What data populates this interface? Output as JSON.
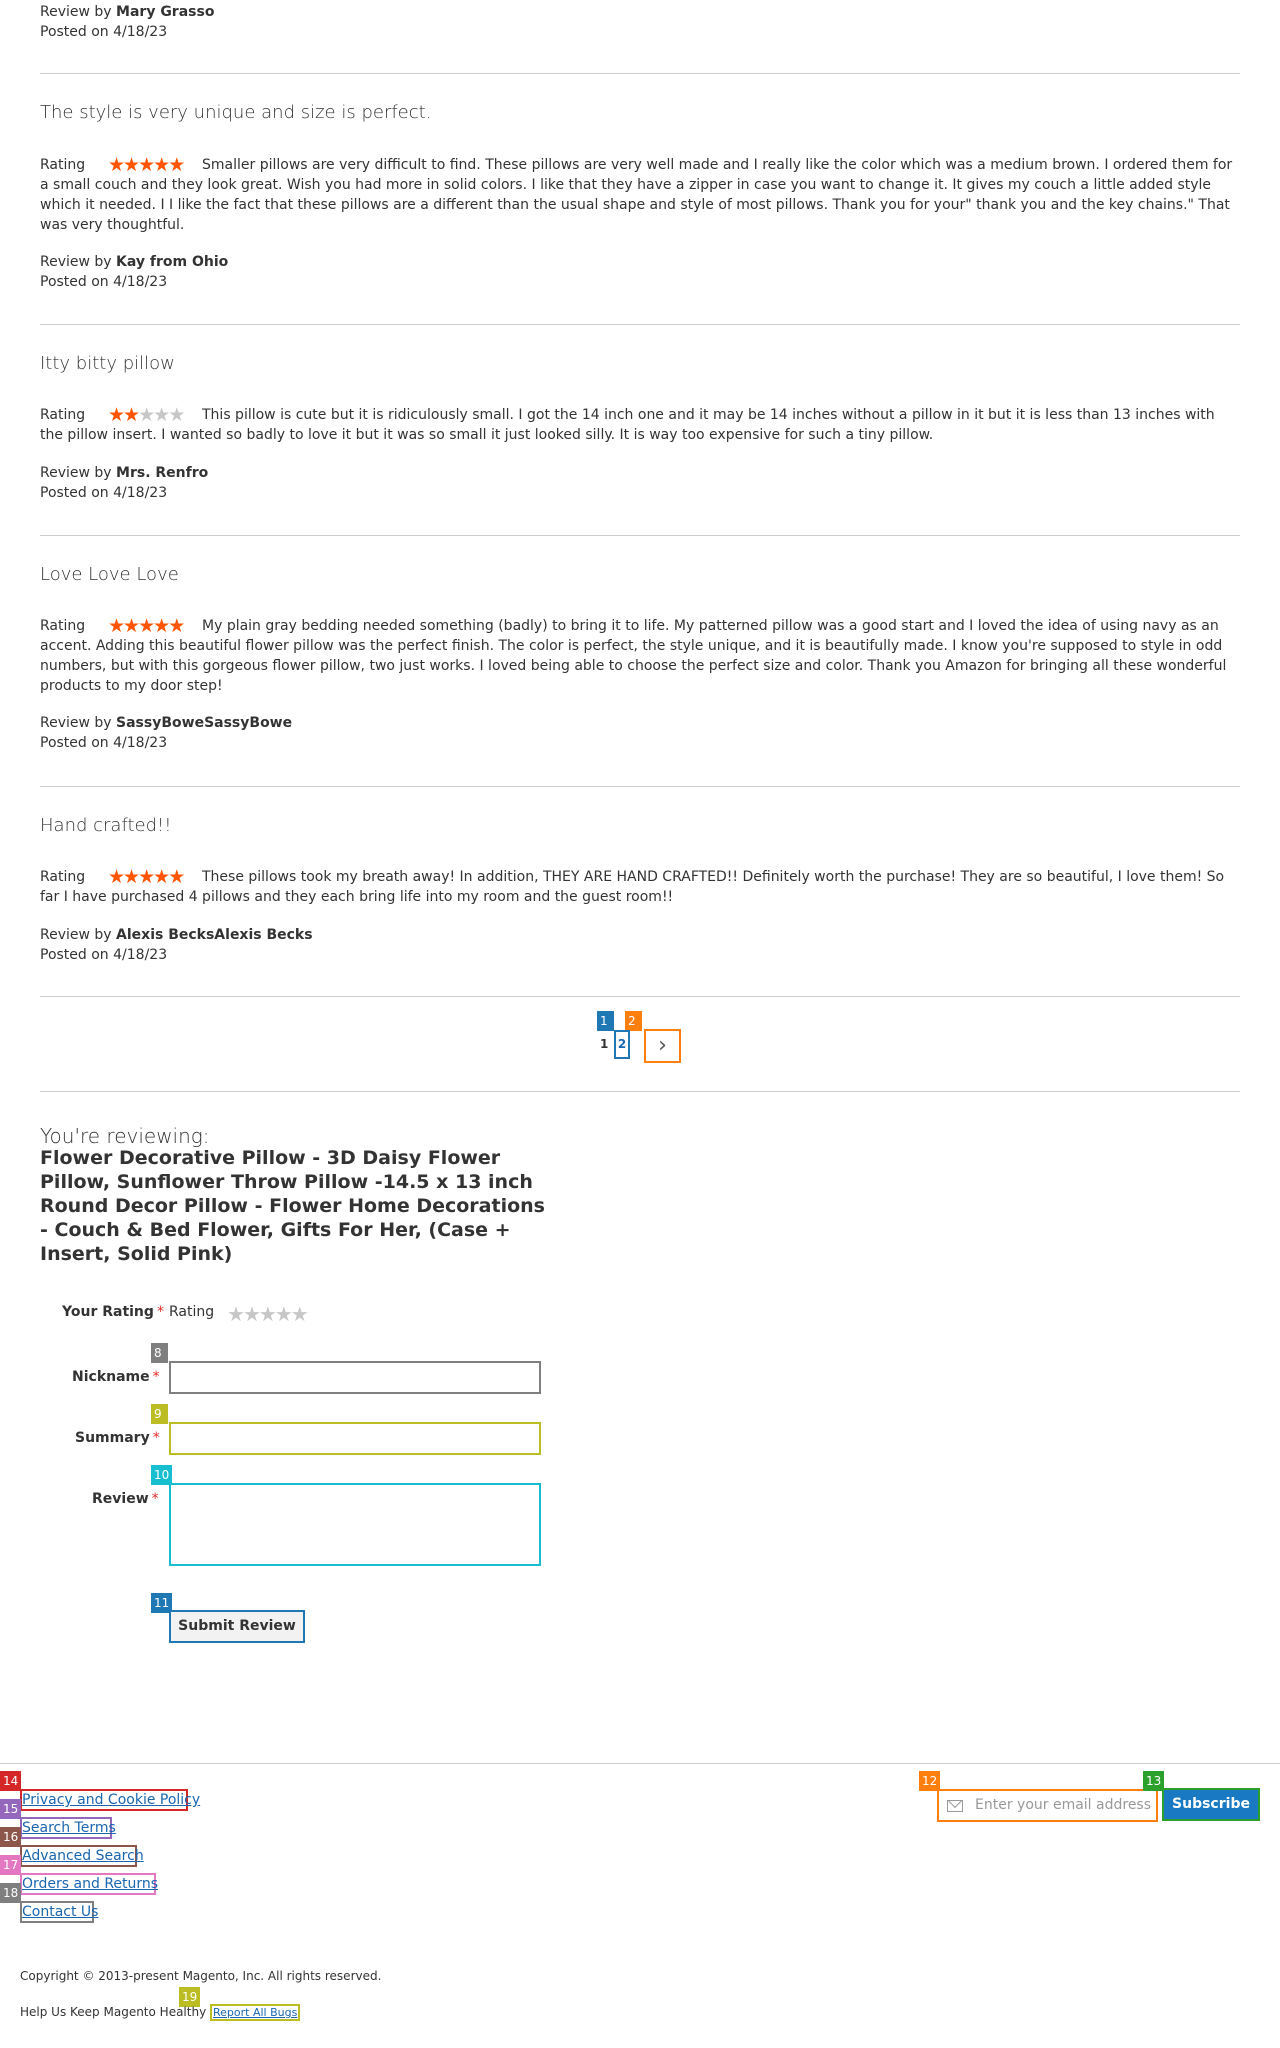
{
  "first_review_meta": {
    "review_by_label": "Review by",
    "author": "Mary Grasso",
    "posted": "Posted on 4/18/23"
  },
  "rating_label": "Rating",
  "reviews": [
    {
      "title": "The style is very unique and size is perfect.",
      "stars": 5,
      "text": "Smaller pillows are very difficult to find. These pillows are very well made and I really like the color which was a medium brown. I ordered them for a small couch and they look great. Wish you had more in solid colors. I like that they have a zipper in case you want to change it. It gives my couch a little added style which it needed. I I like the fact that these pillows are a different than the usual shape and style of most pillows. Thank you for your\" thank you and the key chains.\" That was very thoughtful.",
      "review_by_label": "Review by",
      "author": "Kay from Ohio",
      "posted": "Posted on 4/18/23"
    },
    {
      "title": "Itty bitty pillow",
      "stars": 2,
      "text": "This pillow is cute but it is ridiculously small. I got the 14 inch one and it may be 14 inches without a pillow in it but it is less than 13 inches with the pillow insert. I wanted so badly to love it but it was so small it just looked silly. It is way too expensive for such a tiny pillow.",
      "review_by_label": "Review by",
      "author": "Mrs. Renfro",
      "posted": "Posted on 4/18/23"
    },
    {
      "title": "Love Love Love",
      "stars": 5,
      "text": "My plain gray bedding needed something (badly) to bring it to life. My patterned pillow was a good start and I loved the idea of using navy as an accent. Adding this beautiful flower pillow was the perfect finish. The color is perfect, the style unique, and it is beautifully made. I know you're supposed to style in odd numbers, but with this gorgeous flower pillow, two just works. I loved being able to choose the perfect size and color. Thank you Amazon for bringing all these wonderful products to my door step!",
      "review_by_label": "Review by",
      "author": "SassyBoweSassyBowe",
      "posted": "Posted on 4/18/23"
    },
    {
      "title": "Hand crafted!!",
      "stars": 5,
      "text": "These pillows took my breath away! In addition, THEY ARE HAND CRAFTED!! Definitely worth the purchase! They are so beautiful, I love them! So far I have purchased 4 pillows and they each bring life into my room and the guest room!!",
      "review_by_label": "Review by",
      "author": "Alexis BecksAlexis Becks",
      "posted": "Posted on 4/18/23"
    }
  ],
  "pager": {
    "current": "1",
    "next_page": "2",
    "next_icon": "chevron-right-icon",
    "badges": [
      "1",
      "2"
    ]
  },
  "review_form": {
    "reviewing_label": "You're reviewing:",
    "product_name": "Flower Decorative Pillow - 3D Daisy Flower Pillow, Sunflower Throw Pillow -14.5 x 13 inch Round Decor Pillow - Flower Home Decorations - Couch & Bed Flower, Gifts For Her, (Case + Insert, Solid Pink)",
    "your_rating_label": "Your Rating",
    "rating_label": "Rating",
    "required_mark": "*",
    "nickname_label": "Nickname",
    "summary_label": "Summary",
    "review_label": "Review",
    "nickname_value": "",
    "summary_value": "",
    "review_value": "",
    "submit_label": "Submit Review",
    "badges": {
      "nickname": "8",
      "summary": "9",
      "review": "10",
      "submit": "11"
    }
  },
  "footer": {
    "links": [
      {
        "label": "Privacy and Cookie Policy",
        "badge": "14"
      },
      {
        "label": "Search Terms",
        "badge": "15"
      },
      {
        "label": "Advanced Search",
        "badge": "16"
      },
      {
        "label": "Orders and Returns",
        "badge": "17"
      },
      {
        "label": "Contact Us",
        "badge": "18"
      }
    ],
    "newsletter_placeholder": "Enter your email address",
    "newsletter_badge": "12",
    "subscribe_label": "Subscribe",
    "subscribe_badge": "13",
    "copyright": "Copyright © 2013-present Magento, Inc. All rights reserved.",
    "help_text": "Help Us Keep Magento Healthy",
    "report_label": "Report All Bugs",
    "report_badge": "19"
  },
  "colors": {
    "star_on": "#ff5501",
    "star_off": "#c7c7c7",
    "link": "#1a66b0",
    "subscribe_bg": "#1979c3",
    "required": "#e02b27"
  }
}
